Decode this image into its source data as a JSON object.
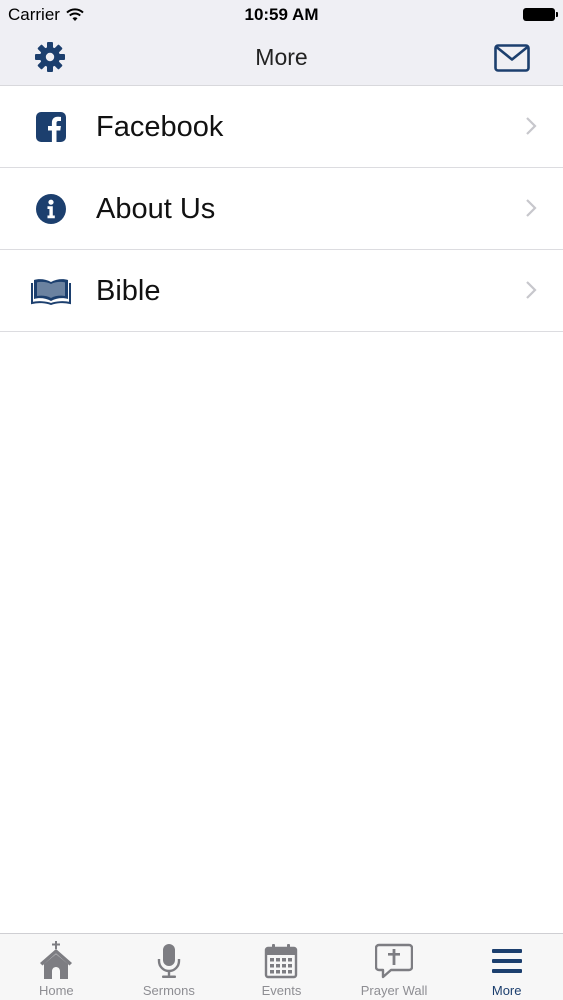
{
  "status_bar": {
    "carrier": "Carrier",
    "time": "10:59 AM"
  },
  "nav": {
    "title": "More",
    "left_icon": "gear-icon",
    "right_icon": "mail-icon"
  },
  "menu": {
    "items": [
      {
        "label": "Facebook",
        "icon": "facebook-icon"
      },
      {
        "label": "About Us",
        "icon": "info-icon"
      },
      {
        "label": "Bible",
        "icon": "bible-icon"
      }
    ]
  },
  "tabs": [
    {
      "label": "Home",
      "icon": "church-icon",
      "active": false
    },
    {
      "label": "Sermons",
      "icon": "microphone-icon",
      "active": false
    },
    {
      "label": "Events",
      "icon": "calendar-icon",
      "active": false
    },
    {
      "label": "Prayer Wall",
      "icon": "prayer-wall-icon",
      "active": false
    },
    {
      "label": "More",
      "icon": "hamburger-icon",
      "active": true
    }
  ],
  "colors": {
    "accent": "#1c3f6e",
    "inactive": "#8e8e93",
    "bar_background": "#efeff4",
    "chevron": "#c7c7cc"
  }
}
